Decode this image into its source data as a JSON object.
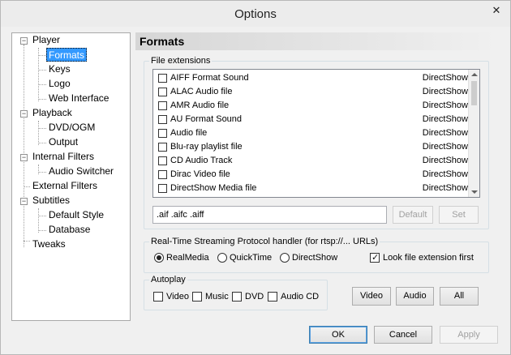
{
  "window": {
    "title": "Options",
    "close_glyph": "✕"
  },
  "tree": {
    "items": [
      {
        "label": "Player"
      },
      {
        "label": "Formats"
      },
      {
        "label": "Keys"
      },
      {
        "label": "Logo"
      },
      {
        "label": "Web Interface"
      },
      {
        "label": "Playback"
      },
      {
        "label": "DVD/OGM"
      },
      {
        "label": "Output"
      },
      {
        "label": "Internal Filters"
      },
      {
        "label": "Audio Switcher"
      },
      {
        "label": "External Filters"
      },
      {
        "label": "Subtitles"
      },
      {
        "label": "Default Style"
      },
      {
        "label": "Database"
      },
      {
        "label": "Tweaks"
      }
    ],
    "selected": "Formats"
  },
  "page": {
    "title": "Formats"
  },
  "file_extensions": {
    "group_label": "File extensions",
    "rows": [
      {
        "name": "AIFF Format Sound",
        "handler": "DirectShow"
      },
      {
        "name": "ALAC Audio file",
        "handler": "DirectShow"
      },
      {
        "name": "AMR Audio file",
        "handler": "DirectShow"
      },
      {
        "name": "AU Format Sound",
        "handler": "DirectShow"
      },
      {
        "name": "Audio file",
        "handler": "DirectShow"
      },
      {
        "name": "Blu-ray playlist file",
        "handler": "DirectShow"
      },
      {
        "name": "CD Audio Track",
        "handler": "DirectShow"
      },
      {
        "name": "Dirac Video file",
        "handler": "DirectShow"
      },
      {
        "name": "DirectShow Media file",
        "handler": "DirectShow"
      }
    ],
    "extensions_value": ".aif .aifc .aiff",
    "default_label": "Default",
    "set_label": "Set"
  },
  "rtsp": {
    "group_label": "Real-Time Streaming Protocol handler (for rtsp://... URLs)",
    "options": [
      "RealMedia",
      "QuickTime",
      "DirectShow"
    ],
    "selected": "RealMedia",
    "look_ext_label": "Look file extension first",
    "look_ext_checked": true
  },
  "autoplay": {
    "group_label": "Autoplay",
    "checks": [
      "Video",
      "Music",
      "DVD",
      "Audio CD"
    ],
    "buttons": [
      "Video",
      "Audio",
      "All"
    ]
  },
  "footer": {
    "ok": "OK",
    "cancel": "Cancel",
    "apply": "Apply"
  }
}
